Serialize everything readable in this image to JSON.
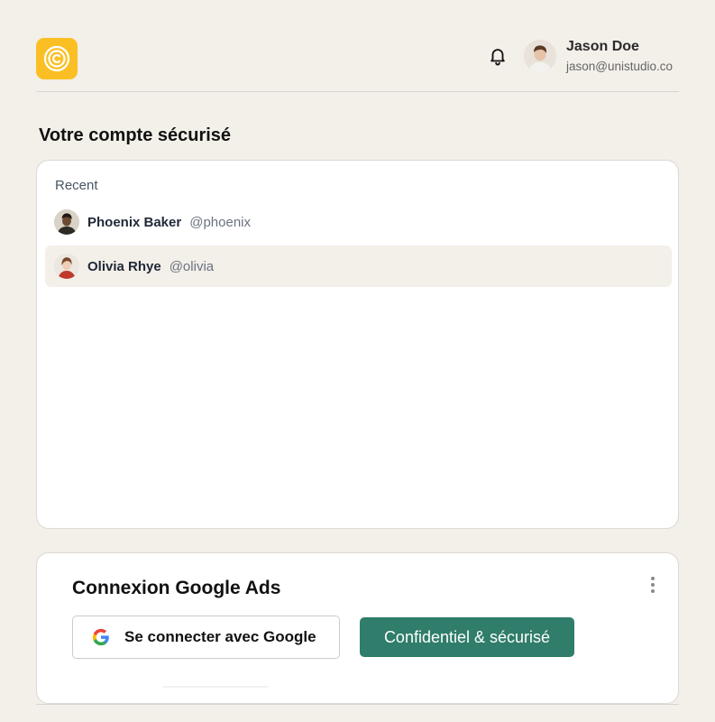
{
  "header": {
    "user": {
      "name": "Jason Doe",
      "email": "jason@unistudio.co"
    },
    "icons": {
      "logo": "app-logo-icon",
      "notifications": "bell-icon"
    },
    "colors": {
      "logo_bg": "#fbbf24"
    }
  },
  "page": {
    "title": "Votre compte sécurisé"
  },
  "recent": {
    "label": "Recent",
    "items": [
      {
        "name": "Phoenix Baker",
        "handle": "@phoenix",
        "selected": false
      },
      {
        "name": "Olivia Rhye",
        "handle": "@olivia",
        "selected": true
      }
    ]
  },
  "google": {
    "title": "Connexion Google Ads",
    "connect_label": "Se connecter avec Google",
    "secure_label": "Confidentiel & sécurisé",
    "icons": {
      "google": "google-icon",
      "menu": "more-vertical-icon"
    },
    "colors": {
      "secure_bg": "#2f7d6a"
    }
  }
}
